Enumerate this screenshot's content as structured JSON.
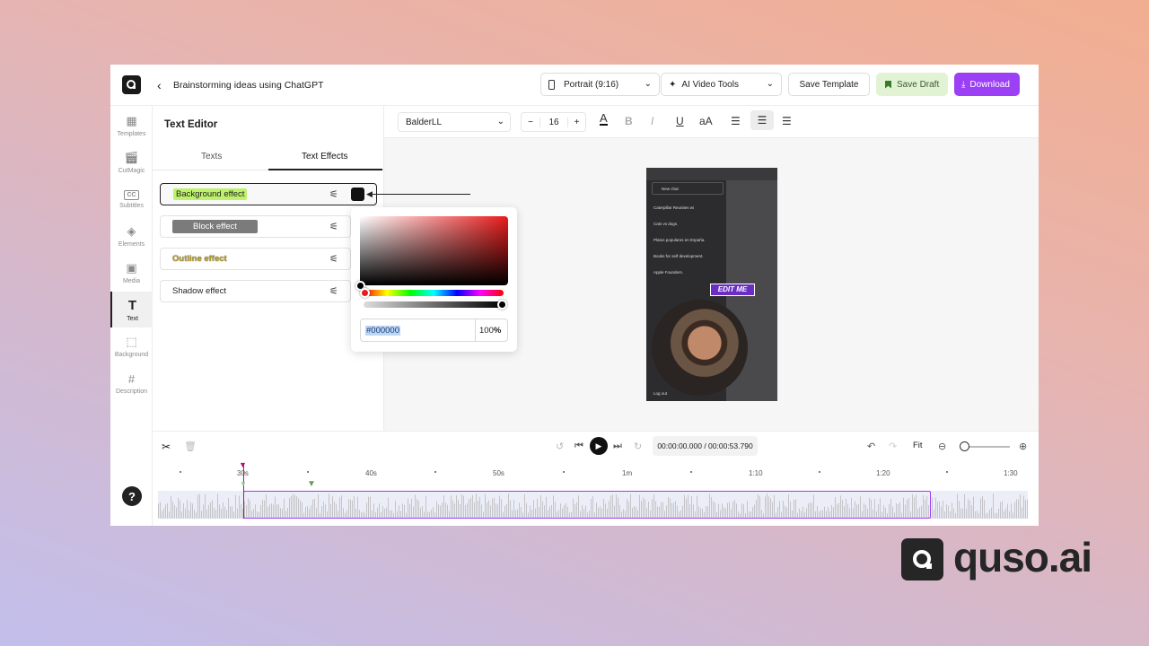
{
  "header": {
    "back_icon": "chevron-left-icon",
    "project_title": "Brainstorming ideas using ChatGPT",
    "aspect_select": "Portrait (9:16)",
    "ai_tools_select": "AI Video Tools",
    "save_template": "Save Template",
    "save_draft": "Save Draft",
    "download": "Download",
    "download_color": "#9b40f5",
    "save_draft_color": "#e2f3d4"
  },
  "nav": {
    "items": [
      {
        "label": "Templates",
        "icon": "templates-icon"
      },
      {
        "label": "CutMagic",
        "icon": "clapperboard-icon"
      },
      {
        "label": "Subtitles",
        "icon": "cc-icon"
      },
      {
        "label": "Elements",
        "icon": "elements-icon"
      },
      {
        "label": "Media",
        "icon": "image-icon"
      },
      {
        "label": "Text",
        "icon": "text-icon"
      },
      {
        "label": "Background",
        "icon": "background-icon"
      },
      {
        "label": "Description",
        "icon": "hash-icon"
      }
    ],
    "active": "Text",
    "help": "?"
  },
  "text_editor": {
    "title": "Text Editor",
    "tabs": [
      "Texts",
      "Text Effects"
    ],
    "active_tab": "Text Effects",
    "effects": [
      "Background effect",
      "Block effect",
      "Outline effect",
      "Shadow effect"
    ],
    "selected_effect": "Background effect",
    "selected_swatch_color": "#000000"
  },
  "toolbar": {
    "font": "BalderLL",
    "size": "16",
    "minus": "−",
    "plus": "+",
    "text_color": "A",
    "bold": "B",
    "italic": "I",
    "underline": "U",
    "case": "aA"
  },
  "color_picker": {
    "hex": "#000000",
    "opacity": "100",
    "percent": "%"
  },
  "preview": {
    "new_chat": "New chat",
    "chats": [
      "Caterpillar Reunites wi",
      "Cats vs dogs.",
      "Platos populares en España.",
      "Books for self development.",
      "Apple Founders."
    ],
    "log_out": "Log out",
    "caption": "EDIT ME"
  },
  "socials": [
    "tiktok-icon",
    "instagram-reels-icon",
    "youtube-shorts-icon"
  ],
  "timeline": {
    "current_time": "00:00:00.000",
    "total_time": "00:00:53.790",
    "fit": "Fit",
    "ruler": [
      "30s",
      "40s",
      "50s",
      "1m",
      "1:10",
      "1:20",
      "1:30"
    ]
  },
  "brand": {
    "name": "quso.ai"
  }
}
